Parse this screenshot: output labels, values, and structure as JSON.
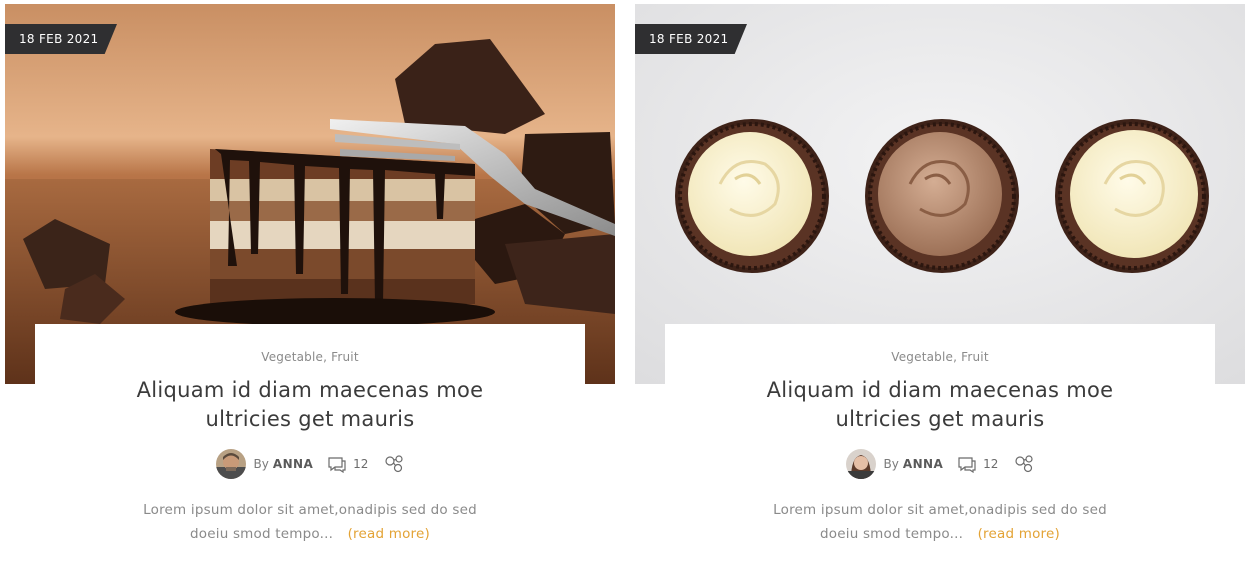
{
  "posts": [
    {
      "date": "18 FEB 2021",
      "categories": "Vegetable, Fruit",
      "title": "Aliquam id diam maecenas moe ultricies get mauris",
      "by_label": "By",
      "author": "ANNA",
      "comments": "12",
      "excerpt": "Lorem ipsum dolor sit amet,onadipis sed do sed doeiu smod tempo...",
      "read_more": "(read more)",
      "image": "chocolate-cake-photo",
      "avatar": "male-avatar"
    },
    {
      "date": "18 FEB 2021",
      "categories": "Vegetable, Fruit",
      "title": "Aliquam id diam maecenas moe ultricies get mauris",
      "by_label": "By",
      "author": "ANNA",
      "comments": "12",
      "excerpt": "Lorem ipsum dolor sit amet,onadipis sed do sed doeiu smod tempo...",
      "read_more": "(read more)",
      "image": "cupcakes-photo",
      "avatar": "female-avatar"
    }
  ],
  "colors": {
    "badge_bg": "#2f2f31",
    "accent": "#e3a335",
    "title": "#3b3b3b",
    "muted": "#8a8a8a"
  }
}
